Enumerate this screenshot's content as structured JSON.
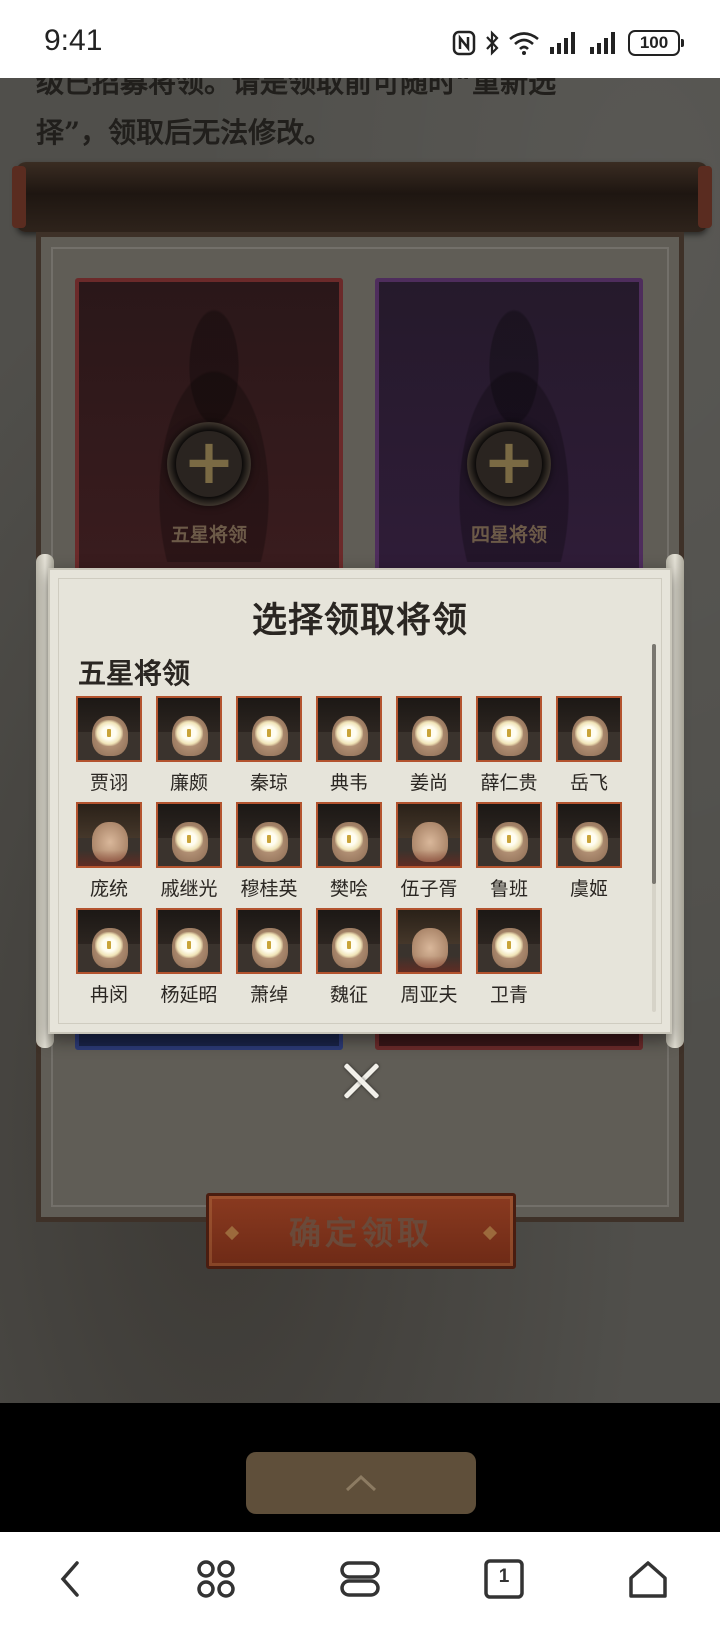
{
  "status_bar": {
    "time": "9:41",
    "battery": "100",
    "icons": [
      "nfc-icon",
      "bluetooth-icon",
      "wifi-icon",
      "signal-icon",
      "signal-icon",
      "battery-icon"
    ]
  },
  "background": {
    "intro_line1": "级已招募将领。请是领取前可随时“重新选",
    "intro_line2": "择”，领取后无法修改。",
    "slot_five_label": "五星将领",
    "slot_four_label": "四星将领",
    "confirm_label": "确定领取"
  },
  "modal": {
    "title": "选择领取将领",
    "section": "五星将领",
    "generals": [
      {
        "name": "贾诩",
        "locked": true
      },
      {
        "name": "廉颇",
        "locked": true
      },
      {
        "name": "秦琼",
        "locked": true
      },
      {
        "name": "典韦",
        "locked": true
      },
      {
        "name": "姜尚",
        "locked": true
      },
      {
        "name": "薛仁贵",
        "locked": true
      },
      {
        "name": "岳飞",
        "locked": true
      },
      {
        "name": "庞统",
        "locked": false
      },
      {
        "name": "戚继光",
        "locked": true
      },
      {
        "name": "穆桂英",
        "locked": true
      },
      {
        "name": "樊哙",
        "locked": true
      },
      {
        "name": "伍子胥",
        "locked": false
      },
      {
        "name": "鲁班",
        "locked": true
      },
      {
        "name": "虞姬",
        "locked": true
      },
      {
        "name": "冉闵",
        "locked": true
      },
      {
        "name": "杨延昭",
        "locked": true
      },
      {
        "name": "萧绰",
        "locked": true
      },
      {
        "name": "魏征",
        "locked": true
      },
      {
        "name": "周亚夫",
        "locked": false
      },
      {
        "name": "卫青",
        "locked": true
      }
    ]
  },
  "nav_bar": {
    "icons": [
      "back-icon",
      "apps-icon",
      "recents-icon",
      "tab-count-icon",
      "home-icon"
    ],
    "tab_count": "1"
  },
  "colors": {
    "accent_border": "#b3532e",
    "paper": "#e6e4da",
    "confirm_button": "#8a3a20"
  }
}
